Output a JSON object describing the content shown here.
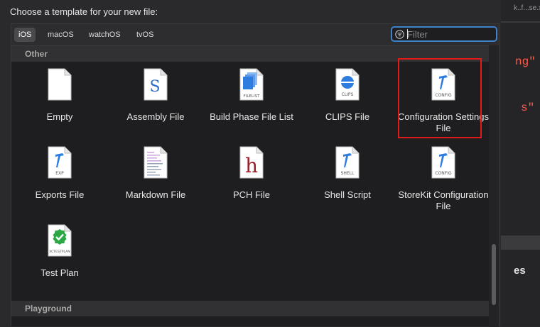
{
  "dialog": {
    "title": "Choose a template for your new file:"
  },
  "platform_tabs": [
    {
      "label": "iOS",
      "selected": true
    },
    {
      "label": "macOS",
      "selected": false
    },
    {
      "label": "watchOS",
      "selected": false
    },
    {
      "label": "tvOS",
      "selected": false
    }
  ],
  "filter": {
    "placeholder": "Filter",
    "value": ""
  },
  "sections": [
    {
      "title": "Other"
    },
    {
      "title": "Playground"
    }
  ],
  "templates": [
    {
      "name": "Empty",
      "icon": "blank-document-icon"
    },
    {
      "name": "Assembly File",
      "icon": "assembly-s-icon"
    },
    {
      "name": "Build Phase File List",
      "icon": "filelist-icon",
      "badge": "FILELIST"
    },
    {
      "name": "CLIPS File",
      "icon": "clips-icon",
      "badge": "CLIPS"
    },
    {
      "name": "Configuration Settings File",
      "icon": "config-hammer-icon",
      "badge": "CONFIG"
    },
    {
      "name": "Exports File",
      "icon": "exp-hammer-icon",
      "badge": "EXP"
    },
    {
      "name": "Markdown File",
      "icon": "markdown-icon"
    },
    {
      "name": "PCH File",
      "icon": "pch-h-icon"
    },
    {
      "name": "Shell Script",
      "icon": "shell-hammer-icon",
      "badge": "SHELL"
    },
    {
      "name": "StoreKit Configuration File",
      "icon": "storekit-config-icon",
      "badge": "CONFIG"
    },
    {
      "name": "Test Plan",
      "icon": "test-plan-check-icon",
      "badge": "XCTESTPLAN"
    }
  ],
  "background_editor": {
    "breadcrumb": "k..f...se.x",
    "code_fragment_1": "ng\"",
    "code_fragment_2": "s\"",
    "partial_text": "es"
  },
  "colors": {
    "accent": "#3f82c9",
    "highlight": "#e01b1b",
    "selected_tab": "#4a4a4d"
  }
}
